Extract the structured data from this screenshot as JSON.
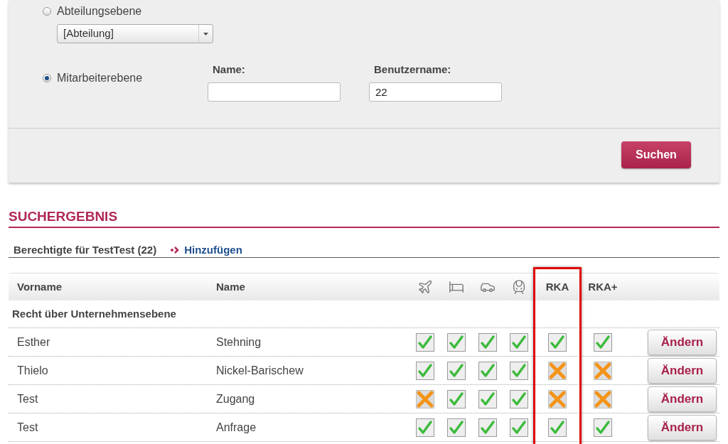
{
  "search_panel": {
    "levels": [
      {
        "kind": "dropdown",
        "label": "Abteilungsebene",
        "selected": false,
        "value": "[Abteilung]"
      },
      {
        "kind": "fields",
        "label": "Mitarbeiterebene",
        "selected": true,
        "fields": [
          {
            "label": "Name:"
          },
          {
            "label": "Benutzername:",
            "value": "22"
          }
        ]
      }
    ],
    "search_button": "Suchen"
  },
  "results": {
    "title": "SUCHERGEBNIS",
    "subtitle": "Berechtigte für TestTest (22)",
    "add_link": "Hinzufügen",
    "columns": [
      {
        "kind": "text",
        "label": "Vorname",
        "highlighted": false
      },
      {
        "kind": "text",
        "label": "Name",
        "highlighted": false
      },
      {
        "kind": "plane",
        "highlighted": false
      },
      {
        "kind": "bed",
        "highlighted": false
      },
      {
        "kind": "car",
        "highlighted": false
      },
      {
        "kind": "train",
        "highlighted": false
      },
      {
        "kind": "text",
        "label": "RKA",
        "highlighted": true
      },
      {
        "kind": "text",
        "label": "RKA+",
        "highlighted": false
      }
    ],
    "group": "Recht über Unternehmensebene",
    "rows": [
      {
        "first_name": "Esther",
        "name": "Stehning",
        "rights": [
          true,
          true,
          true,
          true,
          true,
          true
        ],
        "action": "Ändern"
      },
      {
        "first_name": "Thielo",
        "name": "Nickel-Barischew",
        "rights": [
          true,
          true,
          true,
          true,
          false,
          false
        ],
        "action": "Ändern"
      },
      {
        "first_name": "Test",
        "name": "Zugang",
        "rights": [
          false,
          true,
          true,
          true,
          false,
          false
        ],
        "action": "Ändern"
      },
      {
        "first_name": "Test",
        "name": "Anfrage",
        "rights": [
          true,
          true,
          true,
          true,
          true,
          true
        ],
        "action": "Ändern"
      }
    ]
  }
}
